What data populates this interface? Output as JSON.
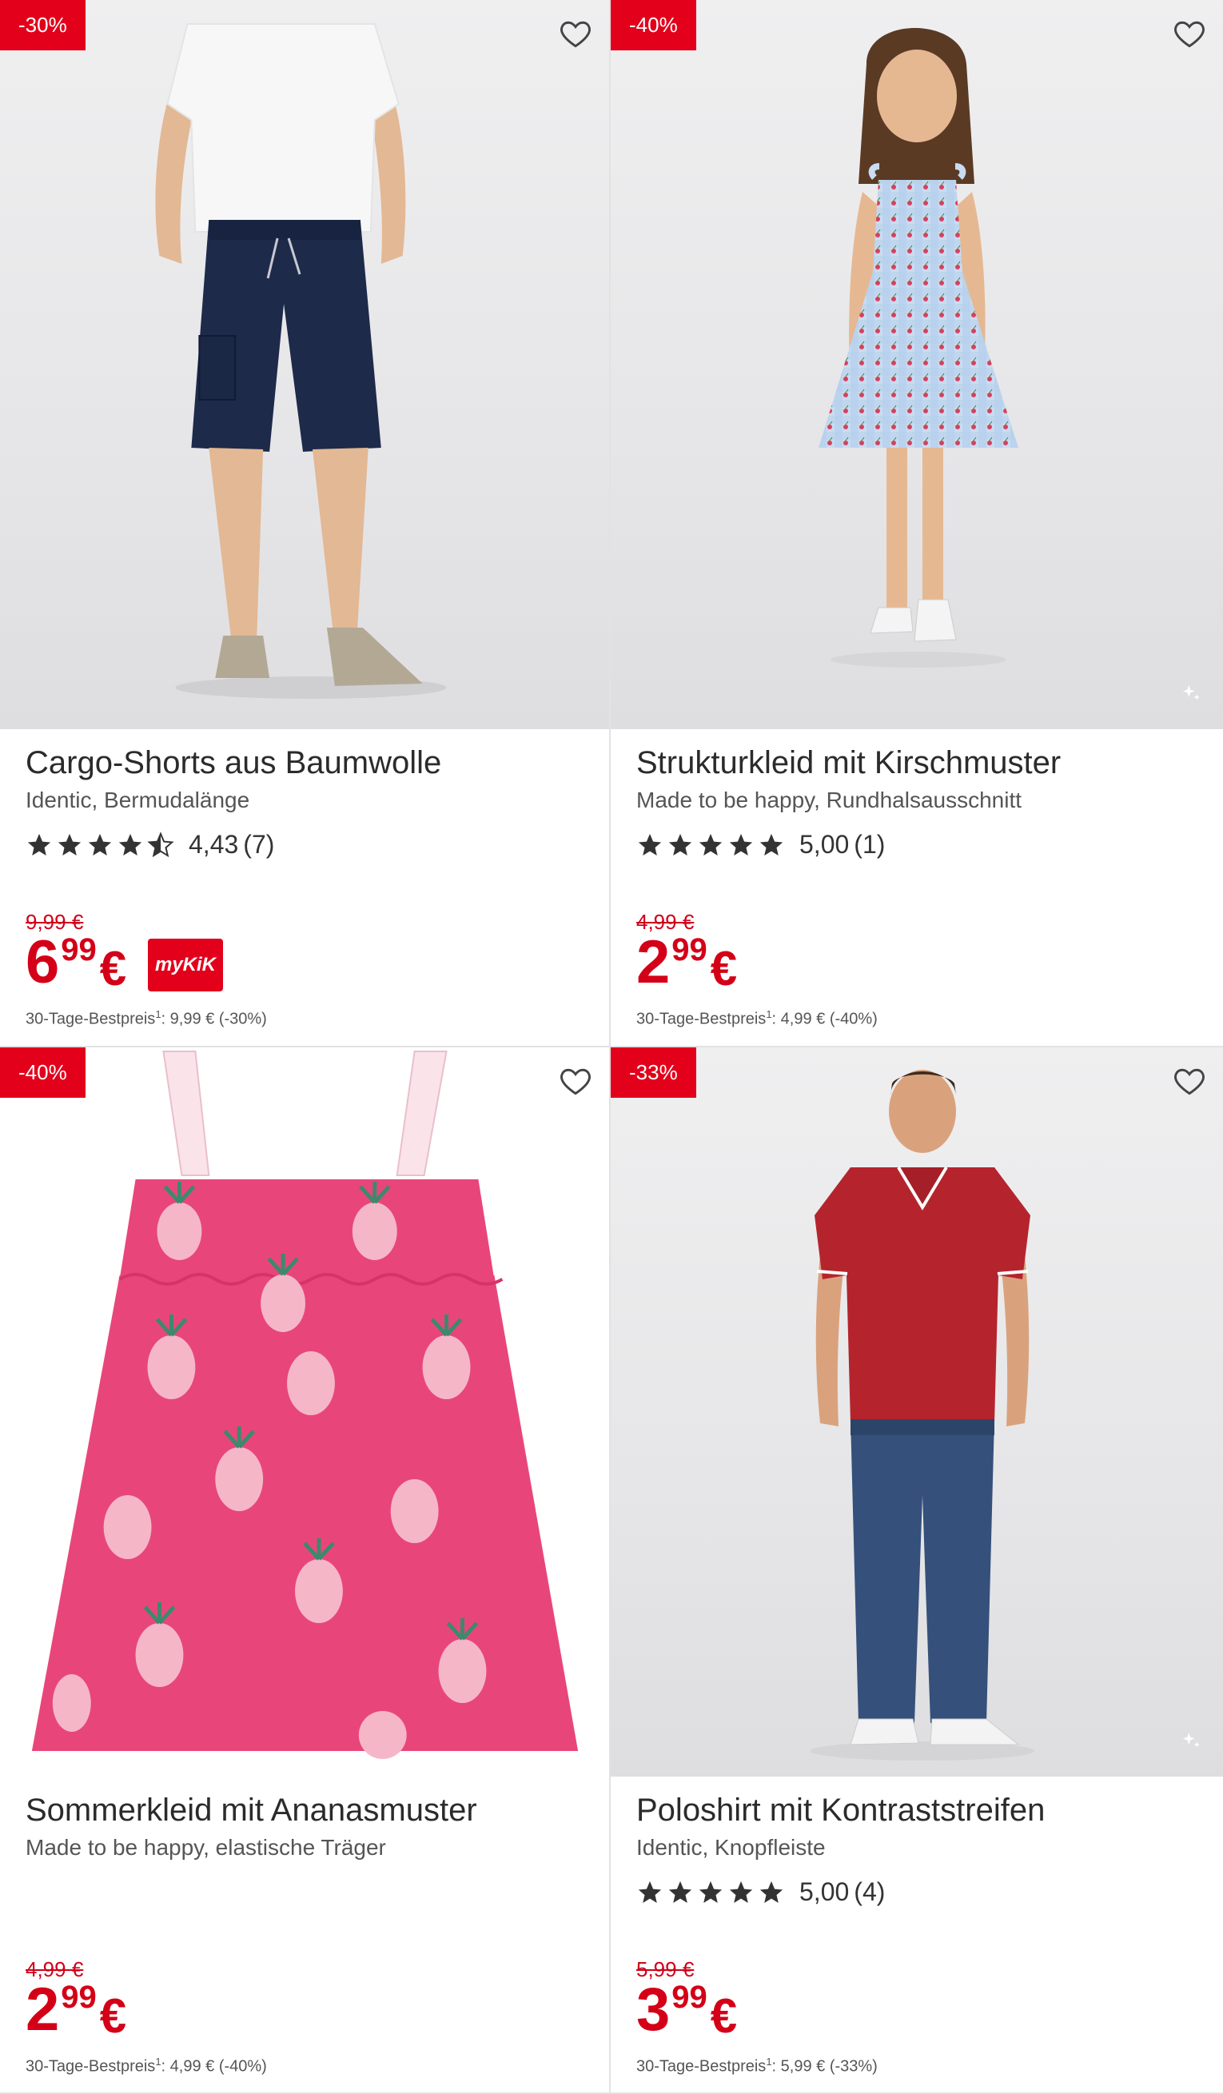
{
  "colors": {
    "accent": "#e3001b",
    "price": "#d40017",
    "star": "#333333"
  },
  "products": [
    {
      "badge": "-30%",
      "title": "Cargo-Shorts aus Baumwolle",
      "subtitle": "Identic, Bermudalänge",
      "rating": {
        "stars": 4.43,
        "score": "4,43",
        "count": "(7)"
      },
      "old_price": "9,99 €",
      "price_int": "6",
      "price_dec": "99",
      "currency": "€",
      "promo_logo": "myKiK",
      "best_label": "30-Tage-Bestpreis",
      "best_sup": "1",
      "best_value": ": 9,99 € (-30%)"
    },
    {
      "badge": "-40%",
      "title": "Strukturkleid mit Kirschmuster",
      "subtitle": "Made to be happy, Rundhalsausschnitt",
      "rating": {
        "stars": 5,
        "score": "5,00",
        "count": "(1)"
      },
      "old_price": "4,99 €",
      "price_int": "2",
      "price_dec": "99",
      "currency": "€",
      "best_label": "30-Tage-Bestpreis",
      "best_sup": "1",
      "best_value": ": 4,99 € (-40%)"
    },
    {
      "badge": "-40%",
      "title": "Sommerkleid mit Ananasmuster",
      "subtitle": "Made to be happy, elastische Träger",
      "old_price": "4,99 €",
      "price_int": "2",
      "price_dec": "99",
      "currency": "€",
      "best_label": "30-Tage-Bestpreis",
      "best_sup": "1",
      "best_value": ": 4,99 € (-40%)"
    },
    {
      "badge": "-33%",
      "title": "Poloshirt mit Kontraststreifen",
      "subtitle": "Identic, Knopfleiste",
      "rating": {
        "stars": 5,
        "score": "5,00",
        "count": "(4)"
      },
      "old_price": "5,99 €",
      "price_int": "3",
      "price_dec": "99",
      "currency": "€",
      "best_label": "30-Tage-Bestpreis",
      "best_sup": "1",
      "best_value": ": 5,99 € (-33%)"
    }
  ]
}
